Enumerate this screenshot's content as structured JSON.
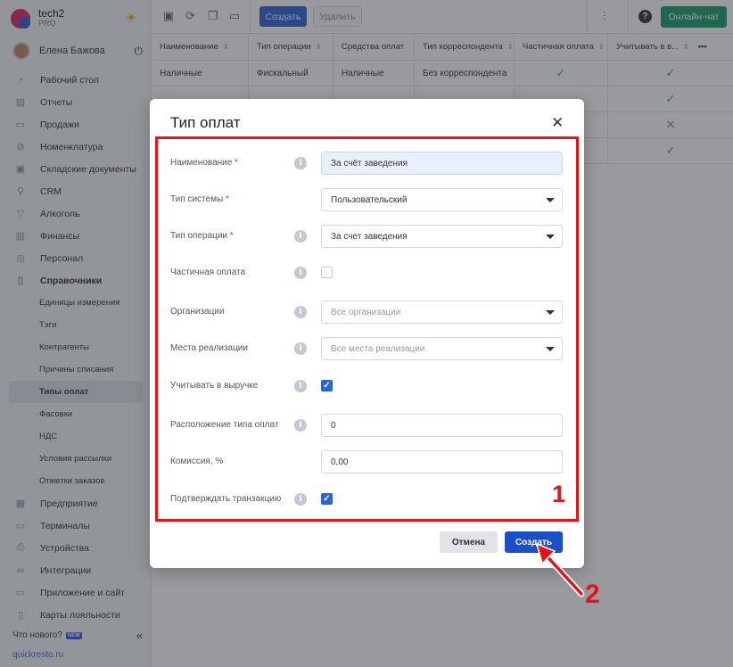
{
  "app": {
    "name": "tech2",
    "edition": "PRO"
  },
  "user": {
    "name": "Елена Бажова"
  },
  "sidebar": {
    "items": [
      {
        "label": "Рабочий стол",
        "icon": "gauge-icon"
      },
      {
        "label": "Отчеты",
        "icon": "chart-icon"
      },
      {
        "label": "Продажи",
        "icon": "cart-icon"
      },
      {
        "label": "Номенклатура",
        "icon": "tag-icon"
      },
      {
        "label": "Складские документы",
        "icon": "box-icon"
      },
      {
        "label": "CRM",
        "icon": "people-icon"
      },
      {
        "label": "Алкоголь",
        "icon": "glass-icon"
      },
      {
        "label": "Финансы",
        "icon": "wallet-icon"
      },
      {
        "label": "Персонал",
        "icon": "person-icon"
      },
      {
        "label": "Справочники",
        "icon": "book-icon"
      }
    ],
    "sub_items": [
      {
        "label": "Единицы измерения"
      },
      {
        "label": "Тэги"
      },
      {
        "label": "Контрагенты"
      },
      {
        "label": "Причины списания"
      },
      {
        "label": "Типы оплат"
      },
      {
        "label": "Фасовки"
      },
      {
        "label": "НДС"
      },
      {
        "label": "Условия рассылки"
      },
      {
        "label": "Отметки заказов"
      }
    ],
    "items_after": [
      {
        "label": "Предприятие",
        "icon": "building-icon"
      },
      {
        "label": "Терминалы",
        "icon": "terminal-icon"
      },
      {
        "label": "Устройства",
        "icon": "printer-icon"
      },
      {
        "label": "Интеграции",
        "icon": "link-icon"
      },
      {
        "label": "Приложение и сайт",
        "icon": "monitor-icon"
      },
      {
        "label": "Карты лояльности",
        "icon": "card-icon"
      }
    ],
    "whats_new": "Что нового?",
    "new_badge": "NEW",
    "site": "quickresto.ru"
  },
  "toolbar": {
    "create_label": "Создать",
    "delete_label": "Удалить",
    "chat_label": "Онлайн-чат",
    "help_label": "?"
  },
  "table": {
    "headers": [
      "Наименование",
      "Тип операции",
      "Средства оплат",
      "Тип корреспондента",
      "Частичная оплата",
      "Учитывать в в..."
    ],
    "rows": [
      [
        "Наличные",
        "Фискальный",
        "Наличные",
        "Без корреспондента",
        "check",
        "check"
      ],
      [
        "",
        "",
        "",
        "",
        "",
        "check"
      ],
      [
        "",
        "",
        "",
        "",
        "",
        "cross"
      ],
      [
        "",
        "",
        "",
        "",
        "",
        "check"
      ]
    ]
  },
  "modal": {
    "title": "Тип оплат",
    "fields": {
      "name": {
        "label": "Наименование",
        "required": "*",
        "value": "За счёт заведения"
      },
      "system_type": {
        "label": "Тип системы",
        "required": "*",
        "value": "Пользовательский"
      },
      "operation_type": {
        "label": "Тип операции",
        "required": "*",
        "value": "За счет заведения"
      },
      "partial": {
        "label": "Частичная оплата",
        "checked": false
      },
      "orgs": {
        "label": "Организации",
        "placeholder": "Все организации"
      },
      "places": {
        "label": "Места реализации",
        "placeholder": "Все места реализации"
      },
      "revenue": {
        "label": "Учитывать в выручке",
        "checked": true
      },
      "position": {
        "label": "Расположение типа оплат",
        "value": "0"
      },
      "commission": {
        "label": "Комиссия, %",
        "value": "0,00"
      },
      "confirm": {
        "label": "Подтверждать транзакцию",
        "checked": true
      }
    },
    "cancel_label": "Отмена",
    "create_label": "Создать"
  },
  "annotations": {
    "one": "1",
    "two": "2"
  },
  "colors": {
    "accent": "#2e62d8",
    "chat": "#1a9e6a",
    "highlight": "#e5131a",
    "check": "#2aa96b"
  }
}
